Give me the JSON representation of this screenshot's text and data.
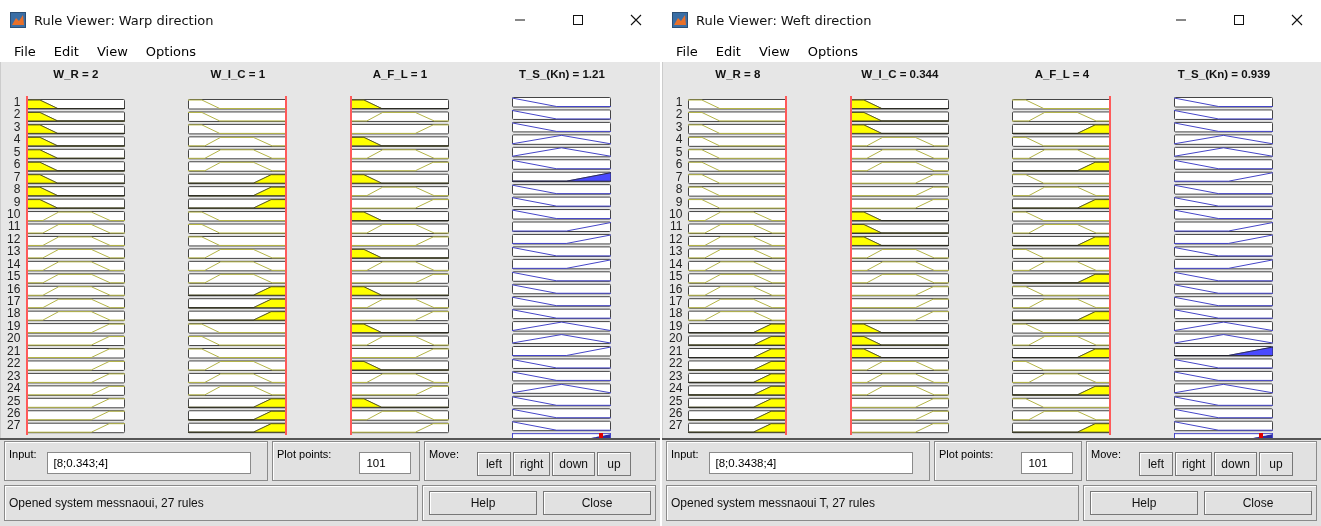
{
  "windows": [
    {
      "title_prefix": "Rule Viewer:",
      "title": "Warp direction",
      "menu": [
        "File",
        "Edit",
        "View",
        "Options"
      ],
      "variables": [
        {
          "label": "W_R = 2",
          "kind": "input",
          "level": 0
        },
        {
          "label": "W_I_C = 1",
          "kind": "input",
          "level": 1
        },
        {
          "label": "A_F_L = 1",
          "kind": "input",
          "level": 0
        },
        {
          "label": "T_S_(Kn) = 1.21",
          "kind": "output",
          "level": 0.92
        }
      ],
      "rules": [
        {
          "number": "1",
          "terms": [
            {
              "kind": "low"
            },
            {
              "kind": "low"
            },
            {
              "kind": "low"
            },
            {
              "kind": "low"
            }
          ]
        },
        {
          "number": "2",
          "terms": [
            {
              "kind": "low"
            },
            {
              "kind": "low"
            },
            {
              "kind": "mid"
            },
            {
              "kind": "low"
            }
          ]
        },
        {
          "number": "3",
          "terms": [
            {
              "kind": "low"
            },
            {
              "kind": "low"
            },
            {
              "kind": "high"
            },
            {
              "kind": "low"
            }
          ]
        },
        {
          "number": "4",
          "terms": [
            {
              "kind": "low"
            },
            {
              "kind": "mid"
            },
            {
              "kind": "low"
            },
            {
              "kind": "mid"
            }
          ]
        },
        {
          "number": "5",
          "terms": [
            {
              "kind": "low"
            },
            {
              "kind": "mid"
            },
            {
              "kind": "mid"
            },
            {
              "kind": "mid"
            }
          ]
        },
        {
          "number": "6",
          "terms": [
            {
              "kind": "low"
            },
            {
              "kind": "mid"
            },
            {
              "kind": "high"
            },
            {
              "kind": "low"
            }
          ]
        },
        {
          "number": "7",
          "terms": [
            {
              "kind": "low"
            },
            {
              "kind": "high"
            },
            {
              "kind": "low"
            },
            {
              "kind": "high"
            }
          ]
        },
        {
          "number": "8",
          "terms": [
            {
              "kind": "low"
            },
            {
              "kind": "high"
            },
            {
              "kind": "mid"
            },
            {
              "kind": "low"
            }
          ]
        },
        {
          "number": "9",
          "terms": [
            {
              "kind": "low"
            },
            {
              "kind": "high"
            },
            {
              "kind": "high"
            },
            {
              "kind": "low"
            }
          ]
        },
        {
          "number": "10",
          "terms": [
            {
              "kind": "mid"
            },
            {
              "kind": "low"
            },
            {
              "kind": "low"
            },
            {
              "kind": "low"
            }
          ]
        },
        {
          "number": "11",
          "terms": [
            {
              "kind": "mid"
            },
            {
              "kind": "low"
            },
            {
              "kind": "mid"
            },
            {
              "kind": "high"
            }
          ]
        },
        {
          "number": "12",
          "terms": [
            {
              "kind": "mid"
            },
            {
              "kind": "low"
            },
            {
              "kind": "high"
            },
            {
              "kind": "high"
            }
          ]
        },
        {
          "number": "13",
          "terms": [
            {
              "kind": "mid"
            },
            {
              "kind": "mid"
            },
            {
              "kind": "low"
            },
            {
              "kind": "low"
            }
          ]
        },
        {
          "number": "14",
          "terms": [
            {
              "kind": "mid"
            },
            {
              "kind": "mid"
            },
            {
              "kind": "mid"
            },
            {
              "kind": "high"
            }
          ]
        },
        {
          "number": "15",
          "terms": [
            {
              "kind": "mid"
            },
            {
              "kind": "mid"
            },
            {
              "kind": "high"
            },
            {
              "kind": "low"
            }
          ]
        },
        {
          "number": "16",
          "terms": [
            {
              "kind": "mid"
            },
            {
              "kind": "high"
            },
            {
              "kind": "low"
            },
            {
              "kind": "low"
            }
          ]
        },
        {
          "number": "17",
          "terms": [
            {
              "kind": "mid"
            },
            {
              "kind": "high"
            },
            {
              "kind": "mid"
            },
            {
              "kind": "low"
            }
          ]
        },
        {
          "number": "18",
          "terms": [
            {
              "kind": "mid"
            },
            {
              "kind": "high"
            },
            {
              "kind": "high"
            },
            {
              "kind": "low"
            }
          ]
        },
        {
          "number": "19",
          "terms": [
            {
              "kind": "high"
            },
            {
              "kind": "low"
            },
            {
              "kind": "low"
            },
            {
              "kind": "mid"
            }
          ]
        },
        {
          "number": "20",
          "terms": [
            {
              "kind": "high"
            },
            {
              "kind": "low"
            },
            {
              "kind": "mid"
            },
            {
              "kind": "mid"
            }
          ]
        },
        {
          "number": "21",
          "terms": [
            {
              "kind": "high"
            },
            {
              "kind": "low"
            },
            {
              "kind": "high"
            },
            {
              "kind": "high"
            }
          ]
        },
        {
          "number": "22",
          "terms": [
            {
              "kind": "high"
            },
            {
              "kind": "mid"
            },
            {
              "kind": "low"
            },
            {
              "kind": "low"
            }
          ]
        },
        {
          "number": "23",
          "terms": [
            {
              "kind": "high"
            },
            {
              "kind": "mid"
            },
            {
              "kind": "mid"
            },
            {
              "kind": "low"
            }
          ]
        },
        {
          "number": "24",
          "terms": [
            {
              "kind": "high"
            },
            {
              "kind": "mid"
            },
            {
              "kind": "high"
            },
            {
              "kind": "mid"
            }
          ]
        },
        {
          "number": "25",
          "terms": [
            {
              "kind": "high"
            },
            {
              "kind": "high"
            },
            {
              "kind": "low"
            },
            {
              "kind": "low"
            }
          ]
        },
        {
          "number": "26",
          "terms": [
            {
              "kind": "high"
            },
            {
              "kind": "high"
            },
            {
              "kind": "mid"
            },
            {
              "kind": "low"
            }
          ]
        },
        {
          "number": "27",
          "terms": [
            {
              "kind": "high"
            },
            {
              "kind": "high"
            },
            {
              "kind": "high"
            },
            {
              "kind": "low"
            }
          ]
        }
      ],
      "input": {
        "label": "Input:",
        "value": "[8;0.343;4]"
      },
      "plot_points": {
        "label": "Plot points:",
        "value": "101"
      },
      "move": {
        "label": "Move:",
        "buttons": [
          "left",
          "right",
          "down",
          "up"
        ]
      },
      "status": "Opened system messnaoui, 27 rules",
      "buttons": [
        "Help",
        "Close"
      ]
    },
    {
      "title_prefix": "Rule Viewer:",
      "title": "Weft direction",
      "menu": [
        "File",
        "Edit",
        "View",
        "Options"
      ],
      "variables": [
        {
          "label": "W_R = 8",
          "kind": "input",
          "level": 1
        },
        {
          "label": "W_I_C = 0.344",
          "kind": "input",
          "level": 0
        },
        {
          "label": "A_F_L = 4",
          "kind": "input",
          "level": 1
        },
        {
          "label": "T_S_(Kn) = 0.939",
          "kind": "output",
          "level": 0.9
        }
      ],
      "rules": [
        {
          "number": "1",
          "terms": [
            {
              "kind": "low"
            },
            {
              "kind": "low"
            },
            {
              "kind": "low"
            },
            {
              "kind": "low"
            }
          ]
        },
        {
          "number": "2",
          "terms": [
            {
              "kind": "low"
            },
            {
              "kind": "low"
            },
            {
              "kind": "mid"
            },
            {
              "kind": "low"
            }
          ]
        },
        {
          "number": "3",
          "terms": [
            {
              "kind": "low"
            },
            {
              "kind": "low"
            },
            {
              "kind": "high"
            },
            {
              "kind": "low"
            }
          ]
        },
        {
          "number": "4",
          "terms": [
            {
              "kind": "low"
            },
            {
              "kind": "mid"
            },
            {
              "kind": "low"
            },
            {
              "kind": "mid"
            }
          ]
        },
        {
          "number": "5",
          "terms": [
            {
              "kind": "low"
            },
            {
              "kind": "mid"
            },
            {
              "kind": "mid"
            },
            {
              "kind": "mid"
            }
          ]
        },
        {
          "number": "6",
          "terms": [
            {
              "kind": "low"
            },
            {
              "kind": "mid"
            },
            {
              "kind": "high"
            },
            {
              "kind": "low"
            }
          ]
        },
        {
          "number": "7",
          "terms": [
            {
              "kind": "low"
            },
            {
              "kind": "high"
            },
            {
              "kind": "low"
            },
            {
              "kind": "high"
            }
          ]
        },
        {
          "number": "8",
          "terms": [
            {
              "kind": "low"
            },
            {
              "kind": "high"
            },
            {
              "kind": "mid"
            },
            {
              "kind": "low"
            }
          ]
        },
        {
          "number": "9",
          "terms": [
            {
              "kind": "low"
            },
            {
              "kind": "high"
            },
            {
              "kind": "high"
            },
            {
              "kind": "low"
            }
          ]
        },
        {
          "number": "10",
          "terms": [
            {
              "kind": "mid"
            },
            {
              "kind": "low"
            },
            {
              "kind": "low"
            },
            {
              "kind": "low"
            }
          ]
        },
        {
          "number": "11",
          "terms": [
            {
              "kind": "mid"
            },
            {
              "kind": "low"
            },
            {
              "kind": "mid"
            },
            {
              "kind": "high"
            }
          ]
        },
        {
          "number": "12",
          "terms": [
            {
              "kind": "mid"
            },
            {
              "kind": "low"
            },
            {
              "kind": "high"
            },
            {
              "kind": "high"
            }
          ]
        },
        {
          "number": "13",
          "terms": [
            {
              "kind": "mid"
            },
            {
              "kind": "mid"
            },
            {
              "kind": "low"
            },
            {
              "kind": "low"
            }
          ]
        },
        {
          "number": "14",
          "terms": [
            {
              "kind": "mid"
            },
            {
              "kind": "mid"
            },
            {
              "kind": "mid"
            },
            {
              "kind": "high"
            }
          ]
        },
        {
          "number": "15",
          "terms": [
            {
              "kind": "mid"
            },
            {
              "kind": "mid"
            },
            {
              "kind": "high"
            },
            {
              "kind": "low"
            }
          ]
        },
        {
          "number": "16",
          "terms": [
            {
              "kind": "mid"
            },
            {
              "kind": "high"
            },
            {
              "kind": "low"
            },
            {
              "kind": "low"
            }
          ]
        },
        {
          "number": "17",
          "terms": [
            {
              "kind": "mid"
            },
            {
              "kind": "high"
            },
            {
              "kind": "mid"
            },
            {
              "kind": "low"
            }
          ]
        },
        {
          "number": "18",
          "terms": [
            {
              "kind": "mid"
            },
            {
              "kind": "high"
            },
            {
              "kind": "high"
            },
            {
              "kind": "low"
            }
          ]
        },
        {
          "number": "19",
          "terms": [
            {
              "kind": "high"
            },
            {
              "kind": "low"
            },
            {
              "kind": "low"
            },
            {
              "kind": "mid"
            }
          ]
        },
        {
          "number": "20",
          "terms": [
            {
              "kind": "high"
            },
            {
              "kind": "low"
            },
            {
              "kind": "mid"
            },
            {
              "kind": "mid"
            }
          ]
        },
        {
          "number": "21",
          "terms": [
            {
              "kind": "high"
            },
            {
              "kind": "low"
            },
            {
              "kind": "high"
            },
            {
              "kind": "high"
            }
          ]
        },
        {
          "number": "22",
          "terms": [
            {
              "kind": "high"
            },
            {
              "kind": "mid"
            },
            {
              "kind": "low"
            },
            {
              "kind": "low"
            }
          ]
        },
        {
          "number": "23",
          "terms": [
            {
              "kind": "high"
            },
            {
              "kind": "mid"
            },
            {
              "kind": "mid"
            },
            {
              "kind": "low"
            }
          ]
        },
        {
          "number": "24",
          "terms": [
            {
              "kind": "high"
            },
            {
              "kind": "mid"
            },
            {
              "kind": "high"
            },
            {
              "kind": "mid"
            }
          ]
        },
        {
          "number": "25",
          "terms": [
            {
              "kind": "high"
            },
            {
              "kind": "high"
            },
            {
              "kind": "low"
            },
            {
              "kind": "low"
            }
          ]
        },
        {
          "number": "26",
          "terms": [
            {
              "kind": "high"
            },
            {
              "kind": "high"
            },
            {
              "kind": "mid"
            },
            {
              "kind": "low"
            }
          ]
        },
        {
          "number": "27",
          "terms": [
            {
              "kind": "high"
            },
            {
              "kind": "high"
            },
            {
              "kind": "high"
            },
            {
              "kind": "low"
            }
          ]
        }
      ],
      "input": {
        "label": "Input:",
        "value": "[8;0.3438;4]"
      },
      "plot_points": {
        "label": "Plot points:",
        "value": "101"
      },
      "move": {
        "label": "Move:",
        "buttons": [
          "left",
          "right",
          "down",
          "up"
        ]
      },
      "status": "Opened system messnaoui T, 27 rules",
      "buttons": [
        "Help",
        "Close"
      ]
    }
  ]
}
